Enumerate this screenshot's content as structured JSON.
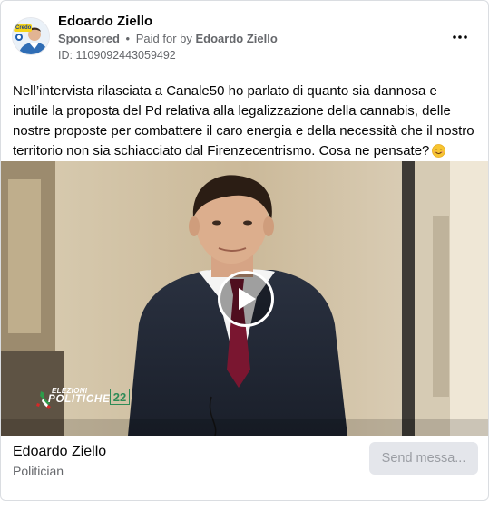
{
  "post": {
    "page_name": "Edoardo Ziello",
    "sponsored_label": "Sponsored",
    "separator": "•",
    "paid_for_prefix": "Paid for by",
    "paid_for_name": "Edoardo Ziello",
    "ad_id": "ID: 1109092443059492",
    "more_icon": "more-options-icon",
    "avatar_badge_text": "Credo",
    "body_text": "Nell’intervista rilasciata a Canale50 ho parlato di quanto sia dannosa e inutile la proposta del Pd relativa alla legalizzazione della cannabis, delle nostre proposte per combattere il caro energia e della necessità che il nostro territorio non sia schiacciato dal Firenzecentrismo. Cosa ne pensate?",
    "emoji_icon": "smiling-face-emoji-icon"
  },
  "video": {
    "play_icon": "play-icon",
    "logo_line1": "ELEZIONI",
    "logo_line2": "POLITICHE",
    "logo_number": "22"
  },
  "footer": {
    "name": "Edoardo Ziello",
    "category": "Politician",
    "send_button_label": "Send messa..."
  },
  "colors": {
    "secondary_text": "#65676b",
    "button_bg": "#e4e6eb",
    "button_text_disabled": "#9a9da3",
    "border": "#dadde1"
  }
}
